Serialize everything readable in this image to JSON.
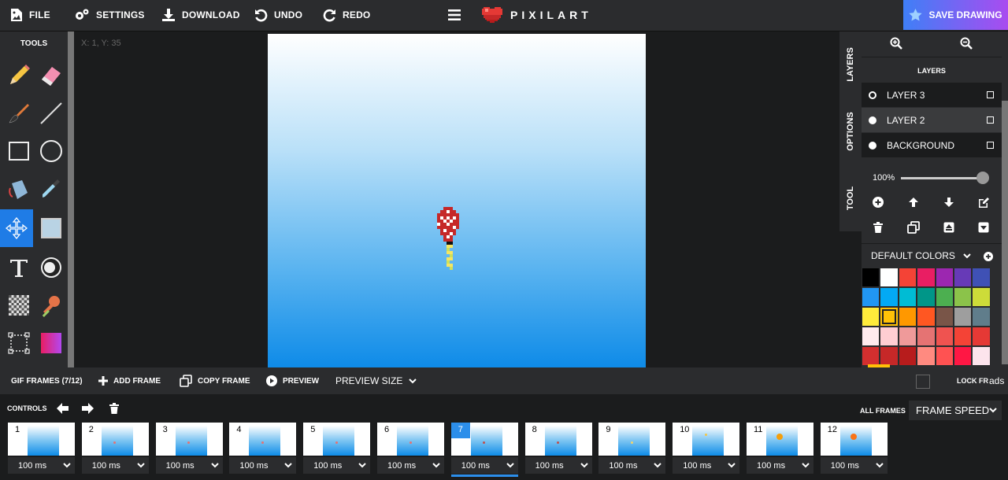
{
  "topbar": {
    "file": "FILE",
    "settings": "SETTINGS",
    "download": "DOWNLOAD",
    "undo": "UNDO",
    "redo": "REDO",
    "logo": "PIXILART",
    "save": "SAVE DRAWING"
  },
  "tools": {
    "title": "TOOLS",
    "items": [
      "pencil-icon",
      "eraser-icon",
      "brush-icon",
      "line-icon",
      "rectangle-icon",
      "circle-icon",
      "fill-bucket-icon",
      "eyedropper-icon",
      "move-icon",
      "select-color-icon",
      "text-icon",
      "shade-icon",
      "dither-icon",
      "stamp-icon",
      "selection-icon",
      "gradient-icon"
    ],
    "active": "move-icon"
  },
  "workspace": {
    "coords": "X: 1, Y: 35"
  },
  "side_tabs": [
    "LAYERS",
    "OPTIONS",
    "TOOL"
  ],
  "layers": {
    "title": "LAYERS",
    "items": [
      {
        "label": "LAYER 3",
        "dot": "hollow"
      },
      {
        "label": "LAYER 2",
        "dot": "filled",
        "selected": true
      },
      {
        "label": "BACKGROUND",
        "dot": "filled"
      }
    ],
    "opacity": "100%",
    "opacity_value": 1.0
  },
  "colors": {
    "title": "DEFAULT COLORS",
    "palette": [
      "#000000",
      "#ffffff",
      "#f44336",
      "#e91e63",
      "#9c27b0",
      "#673ab7",
      "#3f51b5",
      "#2196f3",
      "#03a9f4",
      "#00bcd4",
      "#009688",
      "#4caf50",
      "#8bc34a",
      "#cddc39",
      "#ffeb3b",
      "#ffc107",
      "#ff9800",
      "#ff5722",
      "#795548",
      "#9e9e9e",
      "#607d8b",
      "#ffebee",
      "#ffcdd2",
      "#ef9a9a",
      "#e57373",
      "#ef5350",
      "#f44336",
      "#e53935",
      "#d32f2f",
      "#c62828",
      "#b71c1c",
      "#ff8a80",
      "#ff5252",
      "#ff1744",
      "#fce4ec"
    ],
    "selected_index": 15
  },
  "framebar": {
    "gif_frames": "GIF FRAMES (7/12)",
    "add_frame": "ADD FRAME",
    "copy_frame": "COPY FRAME",
    "preview": "PREVIEW",
    "preview_size": "PREVIEW SIZE",
    "lock": "LOCK FR",
    "ads": "ads"
  },
  "controls": {
    "label": "CONTROLS",
    "all_frames": "ALL FRAMES",
    "frame_speed": "FRAME SPEED"
  },
  "frames": [
    {
      "num": "1",
      "speed": "100 ms"
    },
    {
      "num": "2",
      "speed": "100 ms"
    },
    {
      "num": "3",
      "speed": "100 ms"
    },
    {
      "num": "4",
      "speed": "100 ms"
    },
    {
      "num": "5",
      "speed": "100 ms"
    },
    {
      "num": "6",
      "speed": "100 ms"
    },
    {
      "num": "7",
      "speed": "100 ms",
      "active": true
    },
    {
      "num": "8",
      "speed": "100 ms"
    },
    {
      "num": "9",
      "speed": "100 ms"
    },
    {
      "num": "10",
      "speed": "100 ms"
    },
    {
      "num": "11",
      "speed": "100 ms"
    },
    {
      "num": "12",
      "speed": "100 ms"
    }
  ]
}
